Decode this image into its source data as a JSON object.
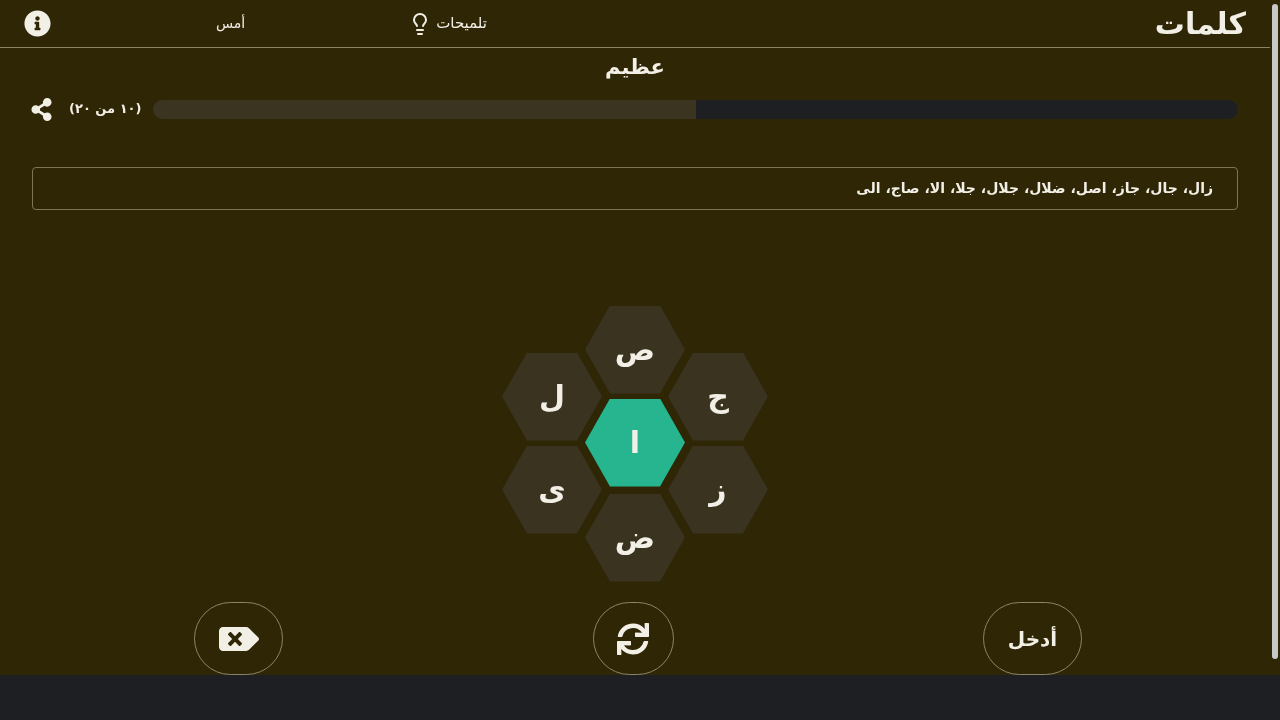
{
  "header": {
    "title": "كلمات",
    "hints": "تلميحات",
    "yesterday": "أمس"
  },
  "rank": "عظيم",
  "progress": {
    "reading": "(١٠ من ٢٠)",
    "level": 0.5
  },
  "found_words": "زال، جال، جاز، اصل، ضلال، جلال، جلا، الا، صاج، الى",
  "letters": [
    {
      "letter": "ص",
      "kind": "outer"
    },
    {
      "letter": "ج",
      "kind": "outer"
    },
    {
      "letter": "ل",
      "kind": "outer"
    },
    {
      "letter": "ا",
      "kind": "center"
    },
    {
      "letter": "ز",
      "kind": "outer"
    },
    {
      "letter": "ى",
      "kind": "outer"
    },
    {
      "letter": "ض",
      "kind": "outer"
    }
  ],
  "enter_button": "أدخل"
}
